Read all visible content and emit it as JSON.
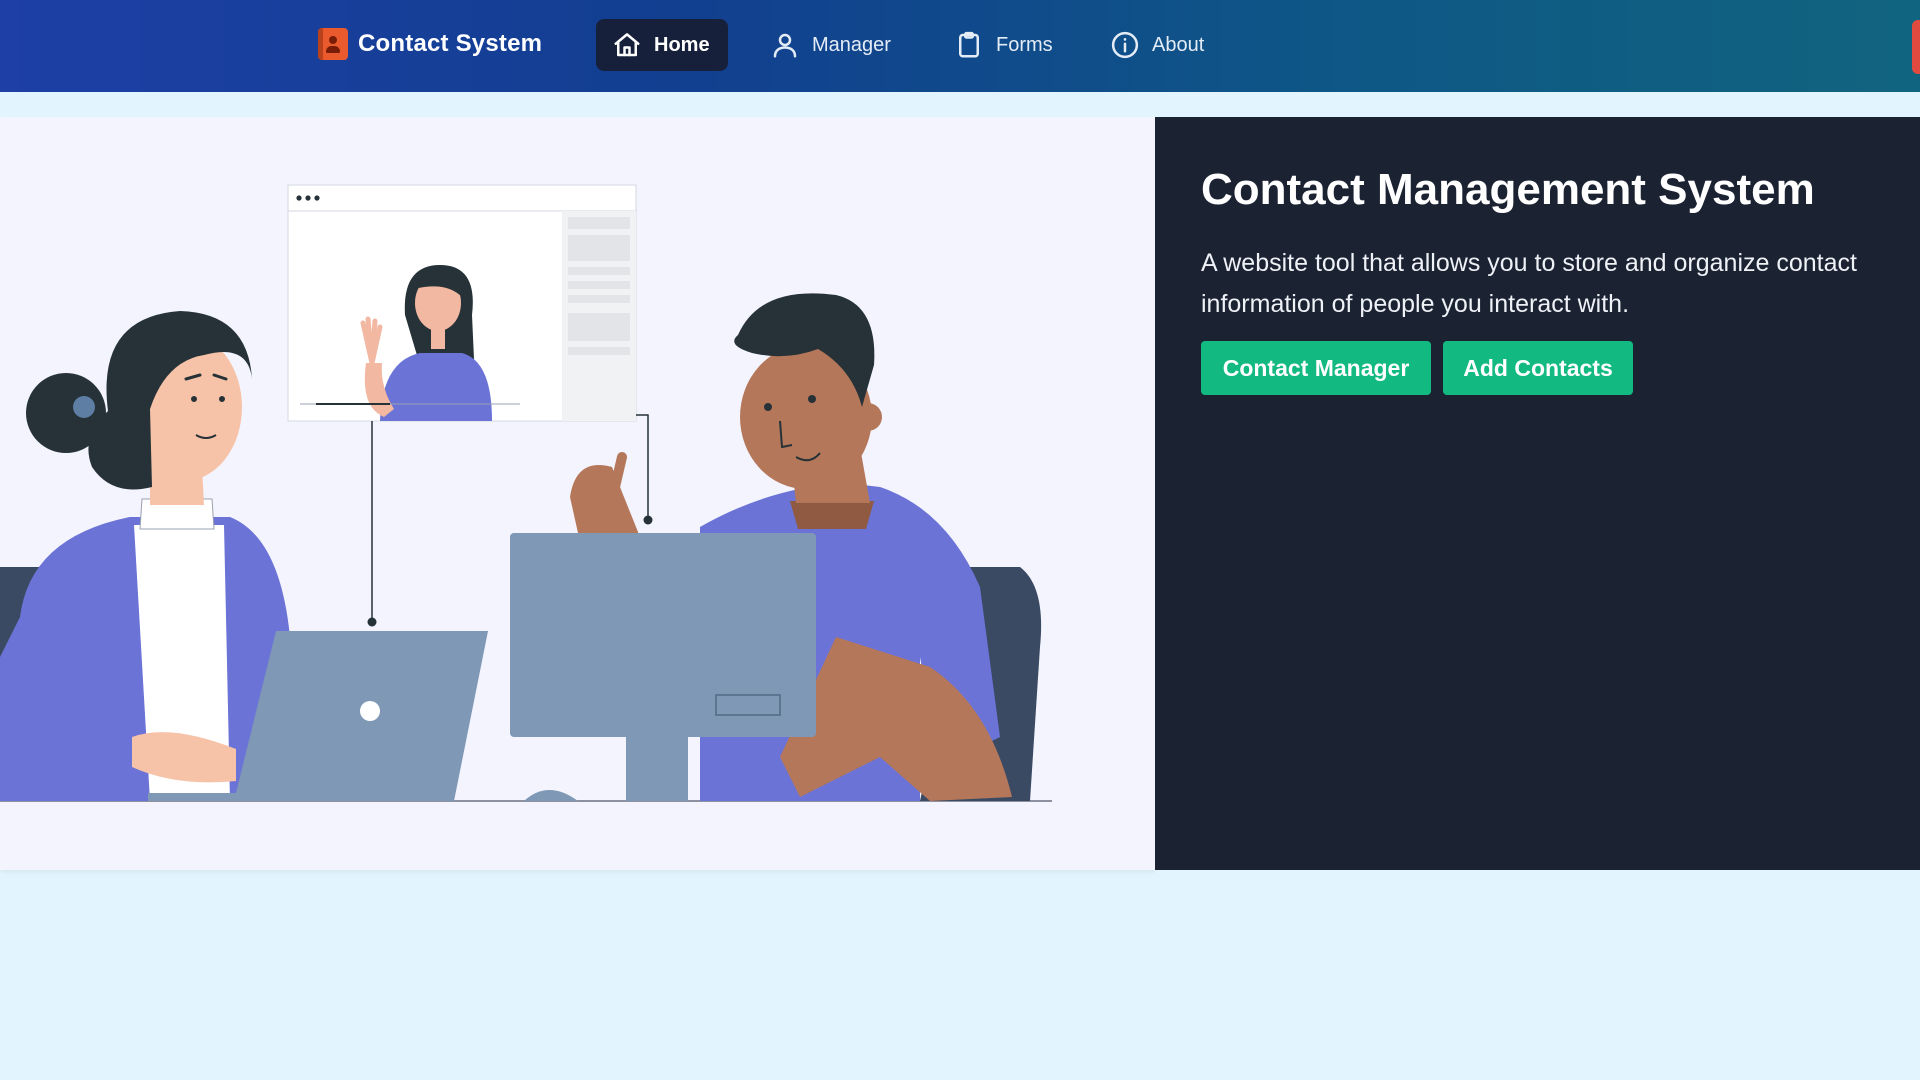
{
  "brand": {
    "name": "Contact System",
    "icon": "contact-book-icon"
  },
  "nav": [
    {
      "label": "Home",
      "icon": "home-icon",
      "active": true
    },
    {
      "label": "Manager",
      "icon": "user-icon",
      "active": false
    },
    {
      "label": "Forms",
      "icon": "clipboard-icon",
      "active": false
    },
    {
      "label": "About",
      "icon": "info-icon",
      "active": false
    }
  ],
  "hero": {
    "title": "Contact Management System",
    "description": "A website tool that allows you to store and organize contact information of people you interact with.",
    "buttons": {
      "primary": "Contact Manager",
      "secondary": "Add Contacts"
    }
  },
  "illustration": {
    "name": "video-call-illustration"
  },
  "colors": {
    "nav_start": "#1d3fa6",
    "nav_end": "#11647f",
    "active_tab": "#17203a",
    "accent_green": "#12b981",
    "hero_dark": "#1b2232",
    "page_bg": "#e2f4fd",
    "brand_orange": "#ea5a2d"
  }
}
